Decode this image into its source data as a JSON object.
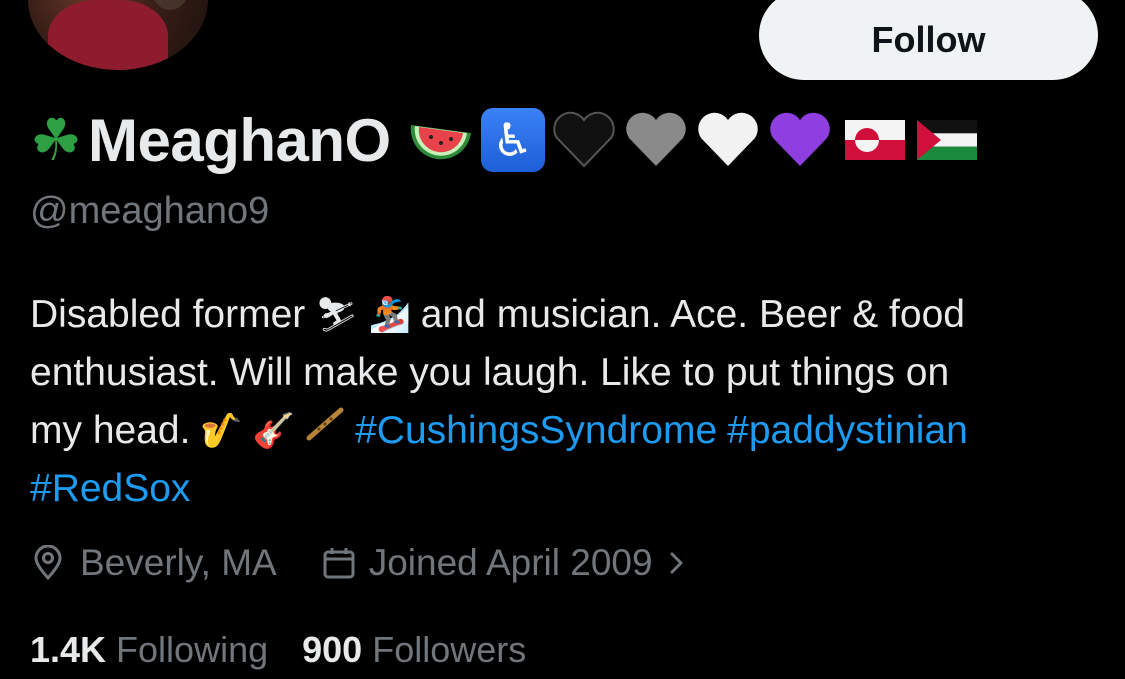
{
  "follow_button": {
    "label": "Follow"
  },
  "profile": {
    "display_name": "MeaghanO",
    "handle": "@meaghano9",
    "name_emoji_icons": [
      "shamrock-icon",
      "watermelon-icon",
      "wheelchair-symbol-icon",
      "black-heart-icon",
      "grey-heart-icon",
      "white-heart-icon",
      "purple-heart-icon",
      "greenland-flag-icon",
      "palestine-flag-icon"
    ]
  },
  "bio": {
    "line1_a": "Disabled former",
    "line1_b": "and musician. Ace. Beer & food",
    "line2": "enthusiast. Will make you laugh. Like to put things on",
    "line3_a": "my head.",
    "hashtag_1": "#CushingsSyndrome",
    "hashtag_2": "#paddystinian",
    "hashtag_3": "#RedSox",
    "emoji_icons": [
      "skier-icon",
      "snowboarder-icon",
      "saxophone-icon",
      "guitar-icon",
      "flute-icon"
    ]
  },
  "meta": {
    "location": "Beverly, MA",
    "joined": "Joined April 2009"
  },
  "stats": {
    "following_count": "1.4K",
    "following_label": "Following",
    "followers_count": "900",
    "followers_label": "Followers"
  },
  "colors": {
    "background": "#000000",
    "text": "#e7e9ea",
    "secondary_text": "#71767b",
    "link": "#1d9bf0",
    "follow_button_bg": "#eff3f4"
  }
}
